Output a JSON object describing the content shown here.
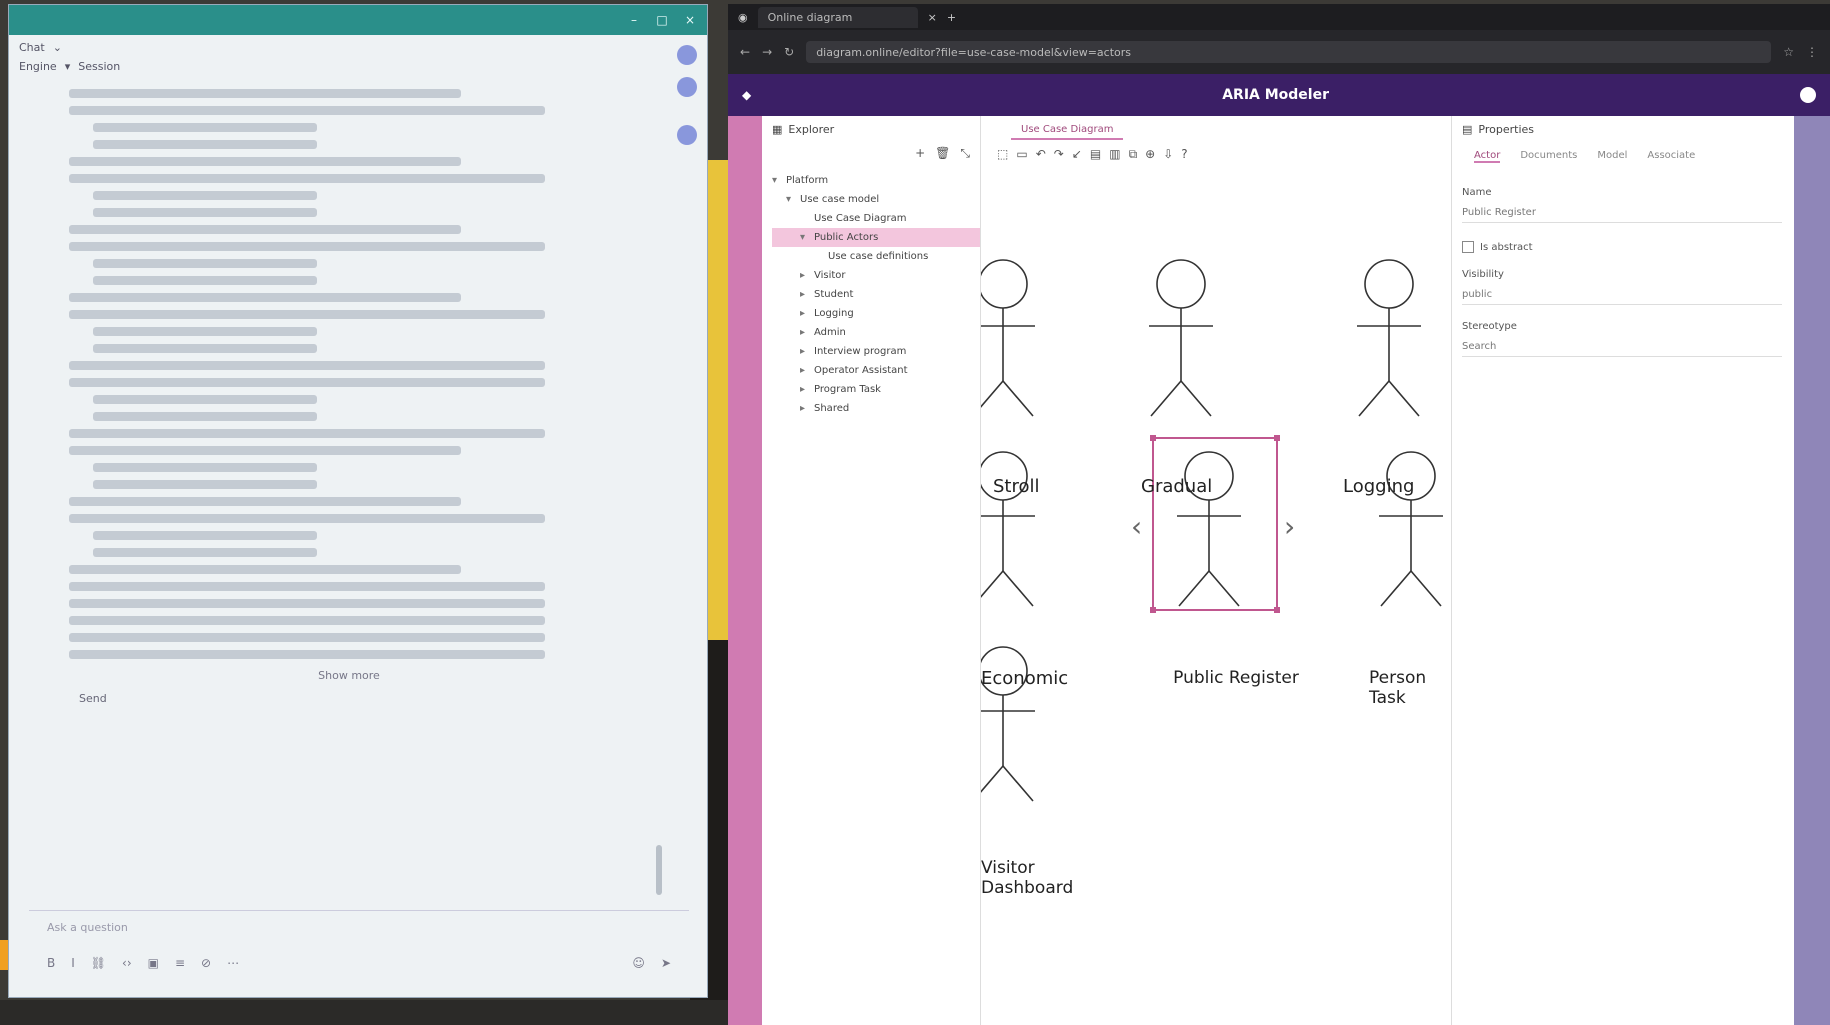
{
  "left_window": {
    "title": "",
    "header": {
      "row1": [
        "Chat",
        "⌄"
      ],
      "row2": [
        "Engine",
        "▾",
        "Session"
      ]
    },
    "expand_label": "Show more",
    "send_label": "Send",
    "input_placeholder": "Ask a question",
    "toolbar_icons": [
      "bold",
      "italic",
      "link",
      "code",
      "image",
      "list",
      "attach",
      "more"
    ]
  },
  "browser": {
    "tab_label": "Online diagram",
    "url": "diagram.online/editor?file=use-case-model&view=actors",
    "app_title": "ARIA Modeler",
    "explorer": {
      "title": "Explorer",
      "tree": [
        {
          "label": "Platform",
          "level": 0,
          "caret": "▾"
        },
        {
          "label": "Use case model",
          "level": 1,
          "caret": "▾"
        },
        {
          "label": "Use Case Diagram",
          "level": 2,
          "caret": ""
        },
        {
          "label": "Public Actors",
          "level": 2,
          "caret": "▾",
          "selected": true
        },
        {
          "label": "Use case definitions",
          "level": 3,
          "caret": ""
        },
        {
          "label": "Visitor",
          "level": 2,
          "caret": "▸"
        },
        {
          "label": "Student",
          "level": 2,
          "caret": "▸"
        },
        {
          "label": "Logging",
          "level": 2,
          "caret": "▸"
        },
        {
          "label": "Admin",
          "level": 2,
          "caret": "▸"
        },
        {
          "label": "Interview program",
          "level": 2,
          "caret": "▸"
        },
        {
          "label": "Operator Assistant",
          "level": 2,
          "caret": "▸"
        },
        {
          "label": "Program Task",
          "level": 2,
          "caret": "▸"
        },
        {
          "label": "Shared",
          "level": 2,
          "caret": "▸"
        }
      ]
    },
    "canvas": {
      "tab": "Use Case Diagram",
      "actors": [
        "Stroll",
        "Gradual",
        "Logging",
        "Economic",
        "Public Register",
        "Person Task",
        "Visitor Dashboard"
      ]
    },
    "properties": {
      "title": "Properties",
      "tabs": [
        "Actor",
        "Documents",
        "Model",
        "Associate"
      ],
      "name_label": "Name",
      "name_value": "Public Register",
      "abstract_label": "Is abstract",
      "visibility_label": "Visibility",
      "visibility_value": "public",
      "stereotype_label": "Stereotype",
      "stereotype_placeholder": "Search"
    }
  }
}
